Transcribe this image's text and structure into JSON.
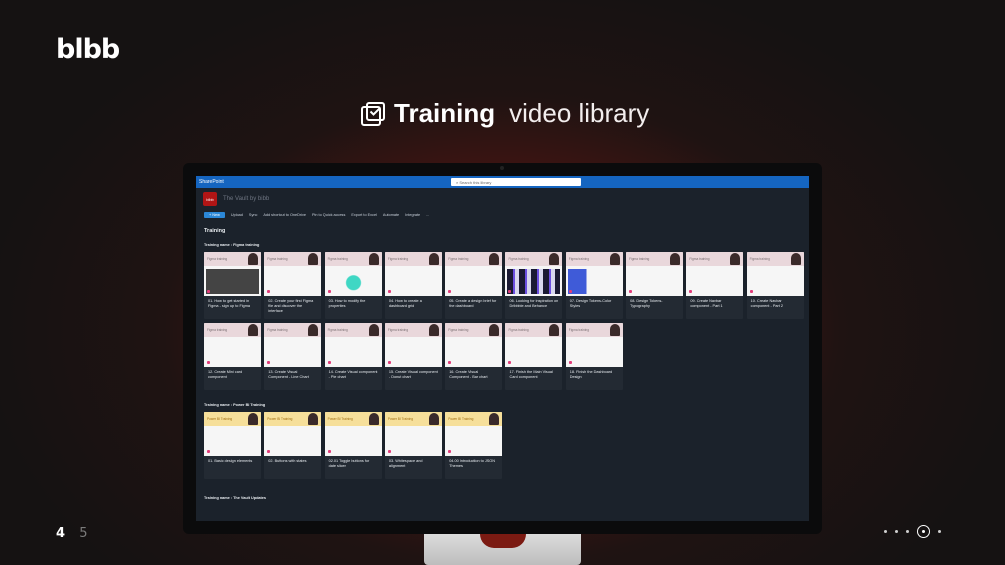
{
  "brand": {
    "logo": "blbb"
  },
  "headline": {
    "strong": "Training",
    "light": "video library",
    "icon": "checklist-icon"
  },
  "sharepoint": {
    "app_name": "SharePoint",
    "search_placeholder": "Search this library",
    "site_title": "The Vault by bibb",
    "commands": [
      "+ New",
      "Upload",
      "Sync",
      "Add shortcut to OneDrive",
      "Pin to Quick access",
      "Export to Excel",
      "Automate",
      "Integrate",
      "..."
    ],
    "library_title": "Training",
    "sections": [
      {
        "title": "Training name : Figma training",
        "tag": "Figma training",
        "cards": [
          "01. How to get started in Figma - sign up to Figma",
          "02. Create your first Figma file and discover the interface",
          "03. How to modify the properties",
          "04. How to create a dashboard grid",
          "05. Create a design brief for the dashboard",
          "06. Looking for inspiration on Dribbble and Behance",
          "07. Design Tokens-Color Styles",
          "08. Design Tokens-Typography",
          "09. Create Navbar component - Part 1",
          "10. Create Navbar component - Part 2",
          "12. Create Mini card component",
          "13. Create Visual Component - Line Chart",
          "14. Create Visual component - Pie chart",
          "15. Create Visual component - Donut chart",
          "16. Create Visual Component - Bar chart",
          "17. Finish the Main Visual Card component",
          "18. Finish the Dashboard Design"
        ]
      },
      {
        "title": "Training name : Power BI Training",
        "tag": "Power BI Training",
        "cards": [
          "01. Basic design elements",
          "02. Buttons with states",
          "02.01 Toggle buttons for date slicer",
          "03. Whitespace and alignment",
          "04.00 Introduction to JSON Themes"
        ]
      },
      {
        "title": "Training name : The Vault Updates",
        "cards": []
      }
    ]
  },
  "pager": {
    "current": "4",
    "next": "5"
  }
}
